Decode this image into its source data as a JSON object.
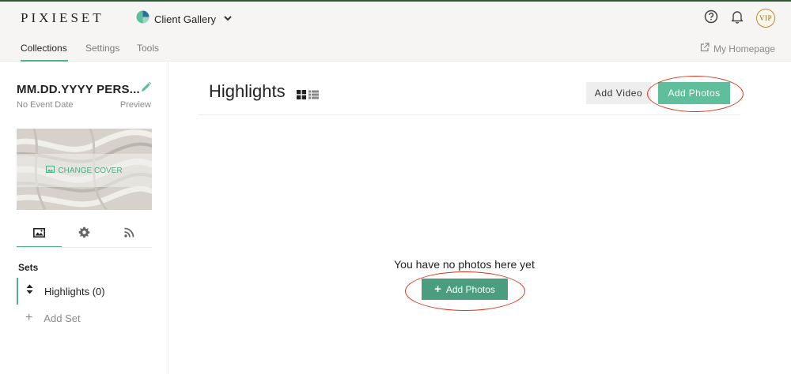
{
  "topbar": {
    "logo": "PIXIESET",
    "app_switcher": {
      "label": "Client Gallery",
      "icon": "client-gallery-icon",
      "chevron": "chevron-down-icon"
    },
    "icons": [
      "help-icon",
      "bell-icon"
    ],
    "vip_badge": "VIP"
  },
  "nav": {
    "tabs": [
      {
        "label": "Collections",
        "active": true
      },
      {
        "label": "Settings",
        "active": false
      },
      {
        "label": "Tools",
        "active": false
      }
    ],
    "my_homepage": "My Homepage"
  },
  "sidebar": {
    "collection_title": "MM.DD.YYYY PERS...",
    "event_date": "No Event Date",
    "preview": "Preview",
    "change_cover": "CHANGE COVER",
    "panel_tabs": [
      {
        "icon": "image-icon",
        "active": true
      },
      {
        "icon": "gear-icon",
        "active": false
      },
      {
        "icon": "rss-icon",
        "active": false
      }
    ],
    "sets_heading": "Sets",
    "sets": [
      {
        "label": "Highlights (0)"
      }
    ],
    "add_set": "Add Set"
  },
  "main": {
    "title": "Highlights",
    "add_video": "Add Video",
    "add_photos_top": "Add Photos",
    "empty_message": "You have no photos here yet",
    "add_photos_center": "Add Photos"
  },
  "colors": {
    "accent": "#51b08f",
    "primary_button": "#5fbe9b",
    "center_button": "#4a9e7f",
    "annotation": "#d8391f"
  }
}
